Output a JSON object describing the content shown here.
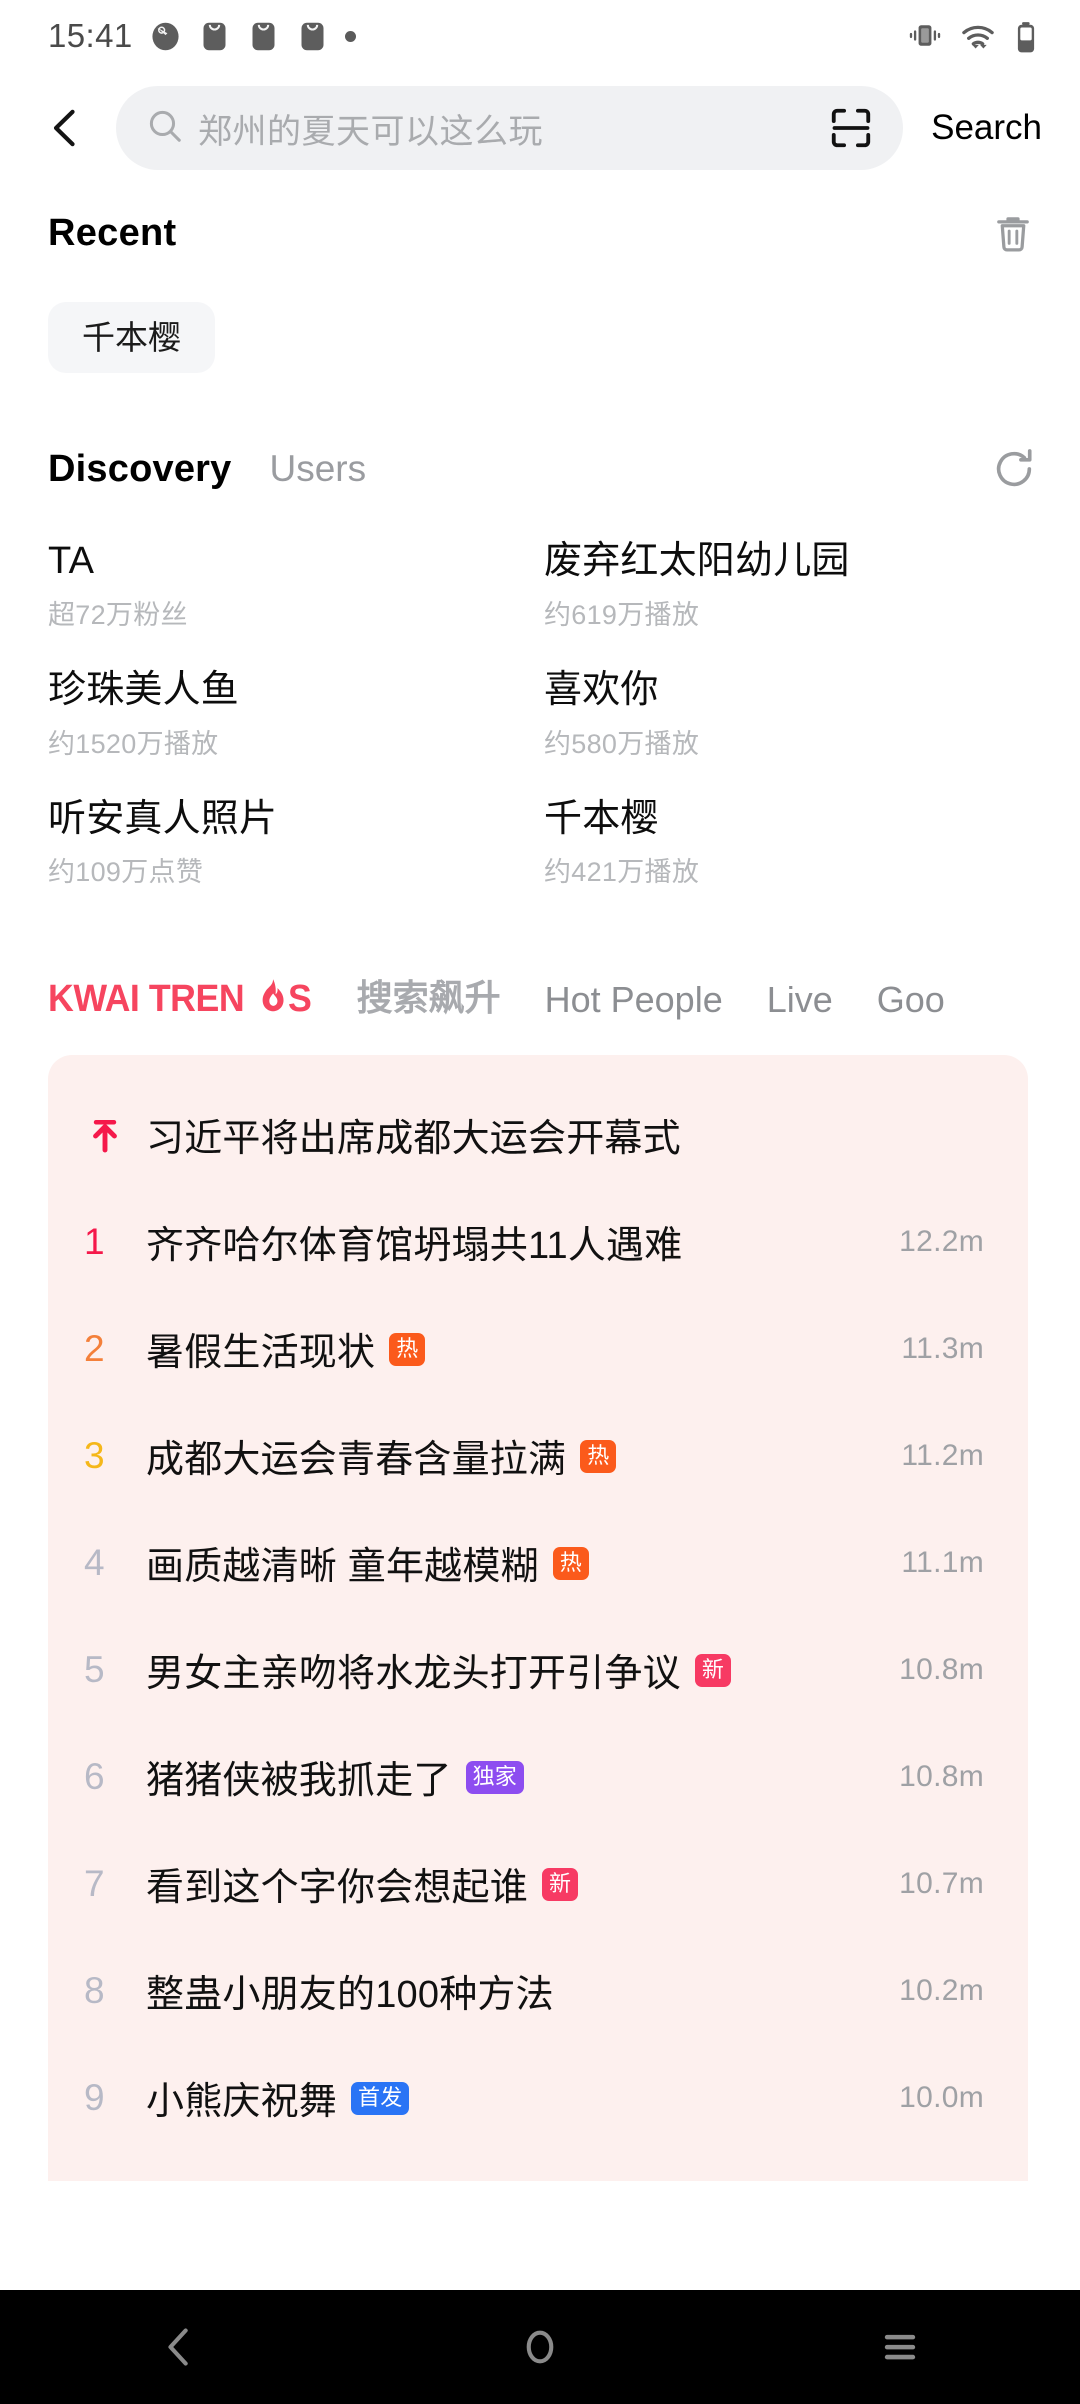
{
  "status_bar": {
    "time": "15:41",
    "left_icons": [
      "clock-icon",
      "app-badge-icon",
      "app-badge-icon",
      "app-badge-icon",
      "dot-icon"
    ],
    "right_icons": [
      "vibrate-icon",
      "wifi-icon",
      "battery-icon"
    ]
  },
  "header": {
    "back_icon": "chevron-left-icon",
    "search_placeholder": "郑州的夏天可以这么玩",
    "search_value": "",
    "search_icon": "magnifier-icon",
    "scan_icon": "scan-frame-icon",
    "search_button": "Search"
  },
  "recent": {
    "title": "Recent",
    "clear_icon": "trash-icon",
    "chips": [
      "千本樱"
    ]
  },
  "discovery": {
    "tabs": [
      {
        "label": "Discovery",
        "active": true
      },
      {
        "label": "Users",
        "active": false
      }
    ],
    "refresh_icon": "refresh-icon",
    "items": [
      {
        "name": "TA",
        "meta": "超72万粉丝"
      },
      {
        "name": "废弃红太阳幼儿园",
        "meta": "约619万播放"
      },
      {
        "name": "珍珠美人鱼",
        "meta": "约1520万播放"
      },
      {
        "name": "喜欢你",
        "meta": "约580万播放"
      },
      {
        "name": "听安真人照片",
        "meta": "约109万点赞"
      },
      {
        "name": "千本樱",
        "meta": "约421万播放"
      }
    ]
  },
  "trend_tabs": {
    "logo_text_a": "KWAI TREN",
    "logo_flame": "flame-icon",
    "logo_text_b": "S",
    "items": [
      {
        "label": "搜索飙升",
        "cn": true
      },
      {
        "label": "Hot People",
        "cn": false
      },
      {
        "label": "Live",
        "cn": false
      },
      {
        "label": "Goo",
        "cn": false
      }
    ]
  },
  "trending": {
    "pinned": {
      "icon": "pin-top-arrow-icon",
      "title": "习近平将出席成都大运会开幕式",
      "heat": ""
    },
    "rows": [
      {
        "rank": "1",
        "rank_color": "#f5184a",
        "title": "齐齐哈尔体育馆坍塌共11人遇难",
        "badge": "",
        "badge_class": "",
        "heat": "12.2m"
      },
      {
        "rank": "2",
        "rank_color": "#f4803a",
        "title": "暑假生活现状",
        "badge": "热",
        "badge_class": "b-hot",
        "heat": "11.3m"
      },
      {
        "rank": "3",
        "rank_color": "#f5b719",
        "title": "成都大运会青春含量拉满",
        "badge": "热",
        "badge_class": "b-hot",
        "heat": "11.2m"
      },
      {
        "rank": "4",
        "rank_color": "#b7b9c6",
        "title": "画质越清晰 童年越模糊",
        "badge": "热",
        "badge_class": "b-hot",
        "heat": "11.1m"
      },
      {
        "rank": "5",
        "rank_color": "#b7b9c6",
        "title": "男女主亲吻将水龙头打开引争议",
        "badge": "新",
        "badge_class": "b-new",
        "heat": "10.8m"
      },
      {
        "rank": "6",
        "rank_color": "#b7b9c6",
        "title": "猪猪侠被我抓走了",
        "badge": "独家",
        "badge_class": "b-exc",
        "heat": "10.8m"
      },
      {
        "rank": "7",
        "rank_color": "#b7b9c6",
        "title": "看到这个字你会想起谁",
        "badge": "新",
        "badge_class": "b-new",
        "heat": "10.7m"
      },
      {
        "rank": "8",
        "rank_color": "#b7b9c6",
        "title": "整蛊小朋友的100种方法",
        "badge": "",
        "badge_class": "",
        "heat": "10.2m"
      },
      {
        "rank": "9",
        "rank_color": "#b7b9c6",
        "title": "小熊庆祝舞",
        "badge": "首发",
        "badge_class": "b-first",
        "heat": "10.0m"
      }
    ]
  },
  "nav_bar": {
    "buttons": [
      "back-icon",
      "home-icon",
      "recents-icon"
    ]
  },
  "colors": {
    "brand": "#f6455f",
    "card_bg": "#fdf0ee",
    "chip_bg": "#f5f6f8",
    "search_bg": "#f0f1f3"
  }
}
